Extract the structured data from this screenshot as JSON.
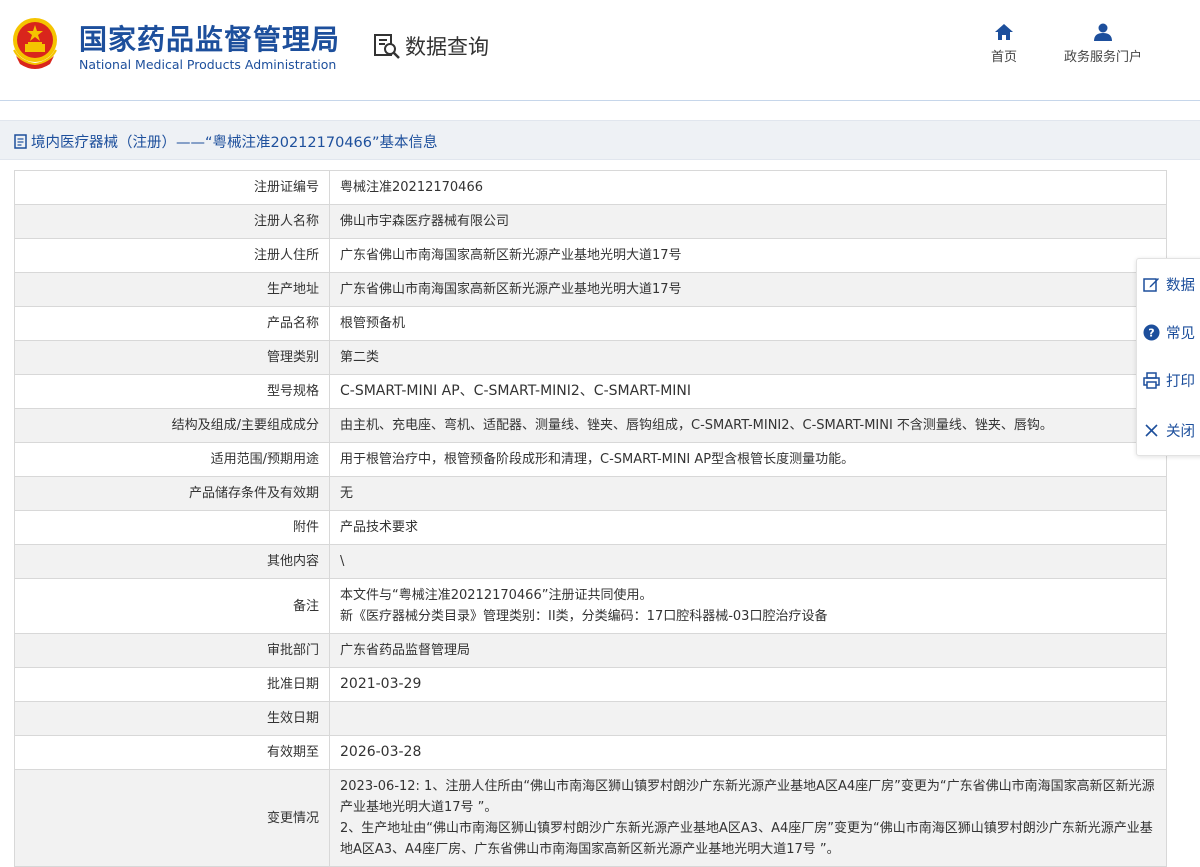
{
  "header": {
    "title_cn": "国家药品监督管理局",
    "title_en": "National Medical Products Administration",
    "query_label": "数据查询",
    "nav": [
      {
        "label": "首页",
        "icon": "home-icon"
      },
      {
        "label": "政务服务门户",
        "icon": "user-icon"
      }
    ]
  },
  "breadcrumb": {
    "text": "境内医疗器械（注册）——“粤械注准20212170466”基本信息",
    "icon": "document-icon"
  },
  "record": {
    "rows": [
      {
        "label": "注册证编号",
        "value": "粤械注准20212170466"
      },
      {
        "label": "注册人名称",
        "value": "佛山市宇森医疗器械有限公司"
      },
      {
        "label": "注册人住所",
        "value": "广东省佛山市南海国家高新区新光源产业基地光明大道17号"
      },
      {
        "label": "生产地址",
        "value": "广东省佛山市南海国家高新区新光源产业基地光明大道17号"
      },
      {
        "label": "产品名称",
        "value": "根管预备机"
      },
      {
        "label": "管理类别",
        "value": "第二类"
      },
      {
        "label": "型号规格",
        "value": "C-SMART-MINI AP、C-SMART-MINI2、C-SMART-MINI"
      },
      {
        "label": "结构及组成/主要组成成分",
        "value": "由主机、充电座、弯机、适配器、测量线、锉夹、唇钩组成，C-SMART-MINI2、C-SMART-MINI 不含测量线、锉夹、唇钩。"
      },
      {
        "label": "适用范围/预期用途",
        "value": "用于根管治疗中，根管预备阶段成形和清理，C-SMART-MINI AP型含根管长度测量功能。"
      },
      {
        "label": "产品储存条件及有效期",
        "value": "无"
      },
      {
        "label": "附件",
        "value": "产品技术要求"
      },
      {
        "label": "其他内容",
        "value": "\\"
      },
      {
        "label": "备注",
        "value_lines": [
          "本文件与“粤械注准20212170466”注册证共同使用。",
          "新《医疗器械分类目录》管理类别：II类，分类编码：17口腔科器械-03口腔治疗设备"
        ]
      },
      {
        "label": "审批部门",
        "value": "广东省药品监督管理局"
      },
      {
        "label": "批准日期",
        "value": "2021-03-29"
      },
      {
        "label": "生效日期",
        "value": ""
      },
      {
        "label": "有效期至",
        "value": "2026-03-28"
      },
      {
        "label": "变更情况",
        "value_lines": [
          "2023-06-12: 1、注册人住所由“佛山市南海区狮山镇罗村朗沙广东新光源产业基地A区A4座厂房”变更为“广东省佛山市南海国家高新区新光源产业基地光明大道17号 ”。",
          "2、生产地址由“佛山市南海区狮山镇罗村朗沙广东新光源产业基地A区A3、A4座厂房”变更为“佛山市南海区狮山镇罗村朗沙广东新光源产业基地A区A3、A4座厂房、广东省佛山市南海国家高新区新光源产业基地光明大道17号 ”。"
        ]
      }
    ]
  },
  "sidepanel": {
    "items": [
      {
        "label": "数据",
        "icon": "edit-icon"
      },
      {
        "label": "常见",
        "icon": "help-icon"
      },
      {
        "label": "打印",
        "icon": "print-icon"
      },
      {
        "label": "关闭",
        "icon": "close-icon"
      }
    ]
  },
  "colors": {
    "brand_blue": "#1d4f9c",
    "emblem_red": "#d9251c",
    "emblem_gold": "#f5c400",
    "row_alt": "#f2f2f2"
  }
}
